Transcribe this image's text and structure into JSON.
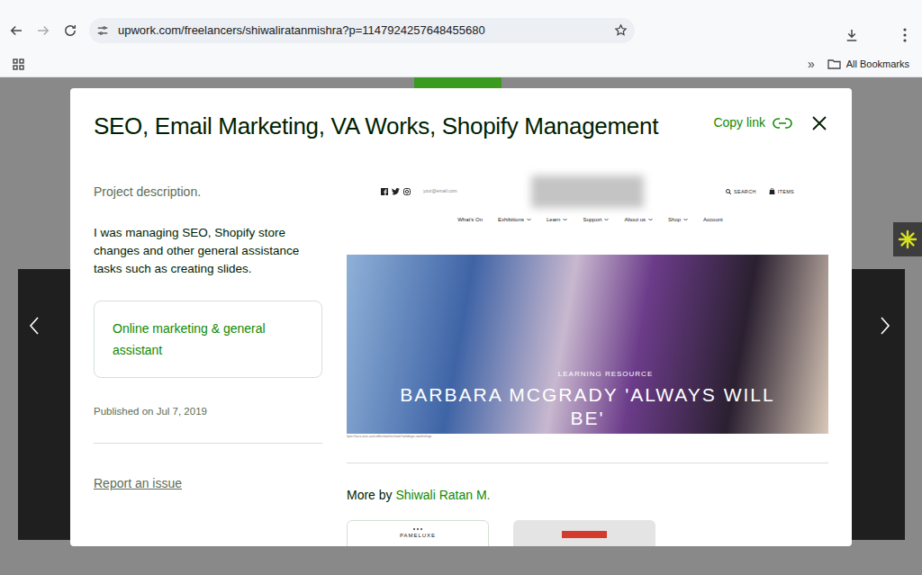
{
  "browser": {
    "url": "upwork.com/freelancers/shiwaliratanmishra?p=1147924257648455680",
    "bookmarks": {
      "overflow": "»",
      "all": "All Bookmarks"
    }
  },
  "modal": {
    "title": "SEO, Email Marketing, VA Works, Shopify Management",
    "copy_link": "Copy link",
    "description_label": "Project description.",
    "description": "I was managing SEO, Shopify store changes and other general assistance tasks such as creating slides.",
    "category": "Online marketing & general assistant",
    "published": "Published on Jul 7, 2019",
    "report": "Report an issue"
  },
  "preview": {
    "email": "your@email.com",
    "search": "SEARCH",
    "cart": "ITEMS",
    "nav": [
      {
        "label": "What's On",
        "dropdown": false
      },
      {
        "label": "Exhibitions",
        "dropdown": true
      },
      {
        "label": "Learn",
        "dropdown": true
      },
      {
        "label": "Support",
        "dropdown": true
      },
      {
        "label": "About us",
        "dropdown": true
      },
      {
        "label": "Shop",
        "dropdown": true
      },
      {
        "label": "Account",
        "dropdown": false
      }
    ],
    "hero": {
      "kicker": "LEARNING RESOURCE",
      "headline": "BARBARA MCGRADY 'ALWAYS WILL BE'"
    },
    "url": "ttps://aca.ans.au/collection/school-holidays-workshop"
  },
  "more_by": {
    "label": "More by",
    "name": "Shiwali Ratan M.",
    "thumbnails": [
      {
        "kind": "logo",
        "text": "PAMELUXE"
      },
      {
        "kind": "banner",
        "text": ""
      }
    ]
  }
}
